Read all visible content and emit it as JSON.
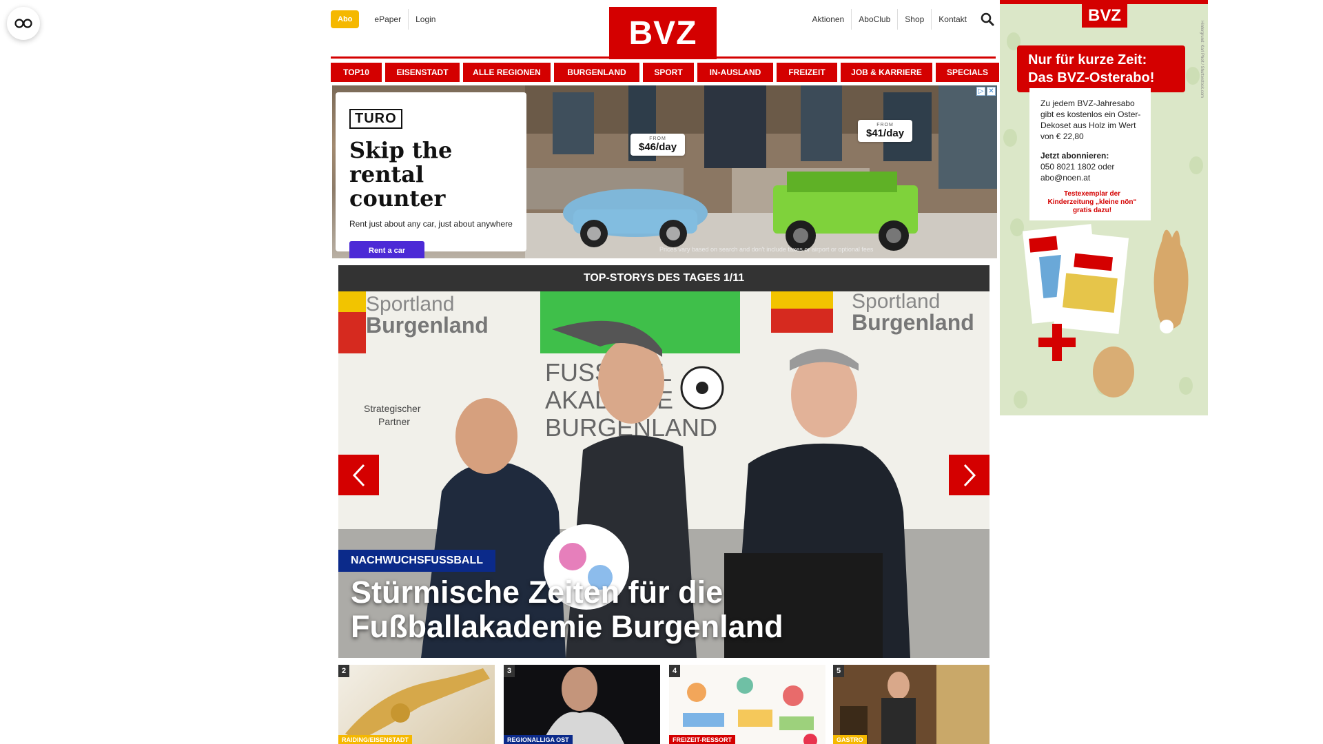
{
  "header": {
    "abo_label": "Abo",
    "left_links": [
      "ePaper",
      "Login"
    ],
    "logo_text": "BVZ",
    "right_links": [
      "Aktionen",
      "AboClub",
      "Shop",
      "Kontakt"
    ]
  },
  "nav": {
    "items": [
      "TOP10",
      "EISENSTADT",
      "ALLE REGIONEN",
      "BURGENLAND",
      "SPORT",
      "IN-AUSLAND",
      "FREIZEIT",
      "JOB & KARRIERE",
      "SPECIALS"
    ]
  },
  "ad": {
    "brand": "TURO",
    "headline": "Skip the rental counter",
    "subline": "Rent just about any car, just about anywhere",
    "cta": "Rent a car",
    "price_from": "FROM",
    "price1": "$46/day",
    "price2": "$41/day",
    "disclaimer": "Prices vary based on search and don't include taxes or airport or optional fees",
    "adchoices": [
      "▷",
      "✕"
    ]
  },
  "stories": {
    "heading": "TOP-STORYS DES TAGES 1/11",
    "kicker": "NACHWUCHSFUSSBALL",
    "title": "Stürmische Zeiten für die Fußballakademie Burgenland",
    "backdrop_left": [
      "Sportland",
      "Burgenland"
    ],
    "backdrop_right": [
      "Sportland",
      "Burgenland"
    ],
    "backdrop_center": [
      "FUSSBALL",
      "AKADEMIE",
      "BURGENLAND"
    ],
    "backdrop_partner": [
      "Strategischer",
      "Partner"
    ],
    "thumbs": [
      {
        "num": "2",
        "tag": "RAIDING/EISENSTADT",
        "color": "#f5b800"
      },
      {
        "num": "3",
        "tag": "REGIONALLIGA OST",
        "color": "#0b2a8a"
      },
      {
        "num": "4",
        "tag": "FREIZEIT-RESSORT",
        "color": "#d40000"
      },
      {
        "num": "5",
        "tag": "GASTRO",
        "color": "#f5b800"
      }
    ]
  },
  "side_ad": {
    "logo": "BVZ",
    "banner": "Nur für kurze Zeit: Das BVZ-Osterabo!",
    "text1": "Zu jedem BVZ-Jahresabo gibt es kostenlos ein Oster-Dekoset aus Holz im Wert von € 22,80",
    "subscribe_label": "Jetzt abonnieren:",
    "contact": "050 8021 1802 oder abo@noen.at",
    "promo": "Testexemplar der Kinderzeitung „kleine nön“ gratis dazu!",
    "plus": "+",
    "copyright": "Hintergrund: Karl Pholt / Shutterstock.com"
  },
  "colors": {
    "brand_red": "#d40000",
    "abo_yellow": "#f5b800",
    "kicker_blue": "#0b2a8a",
    "ad_purple": "#4c2ad6"
  }
}
